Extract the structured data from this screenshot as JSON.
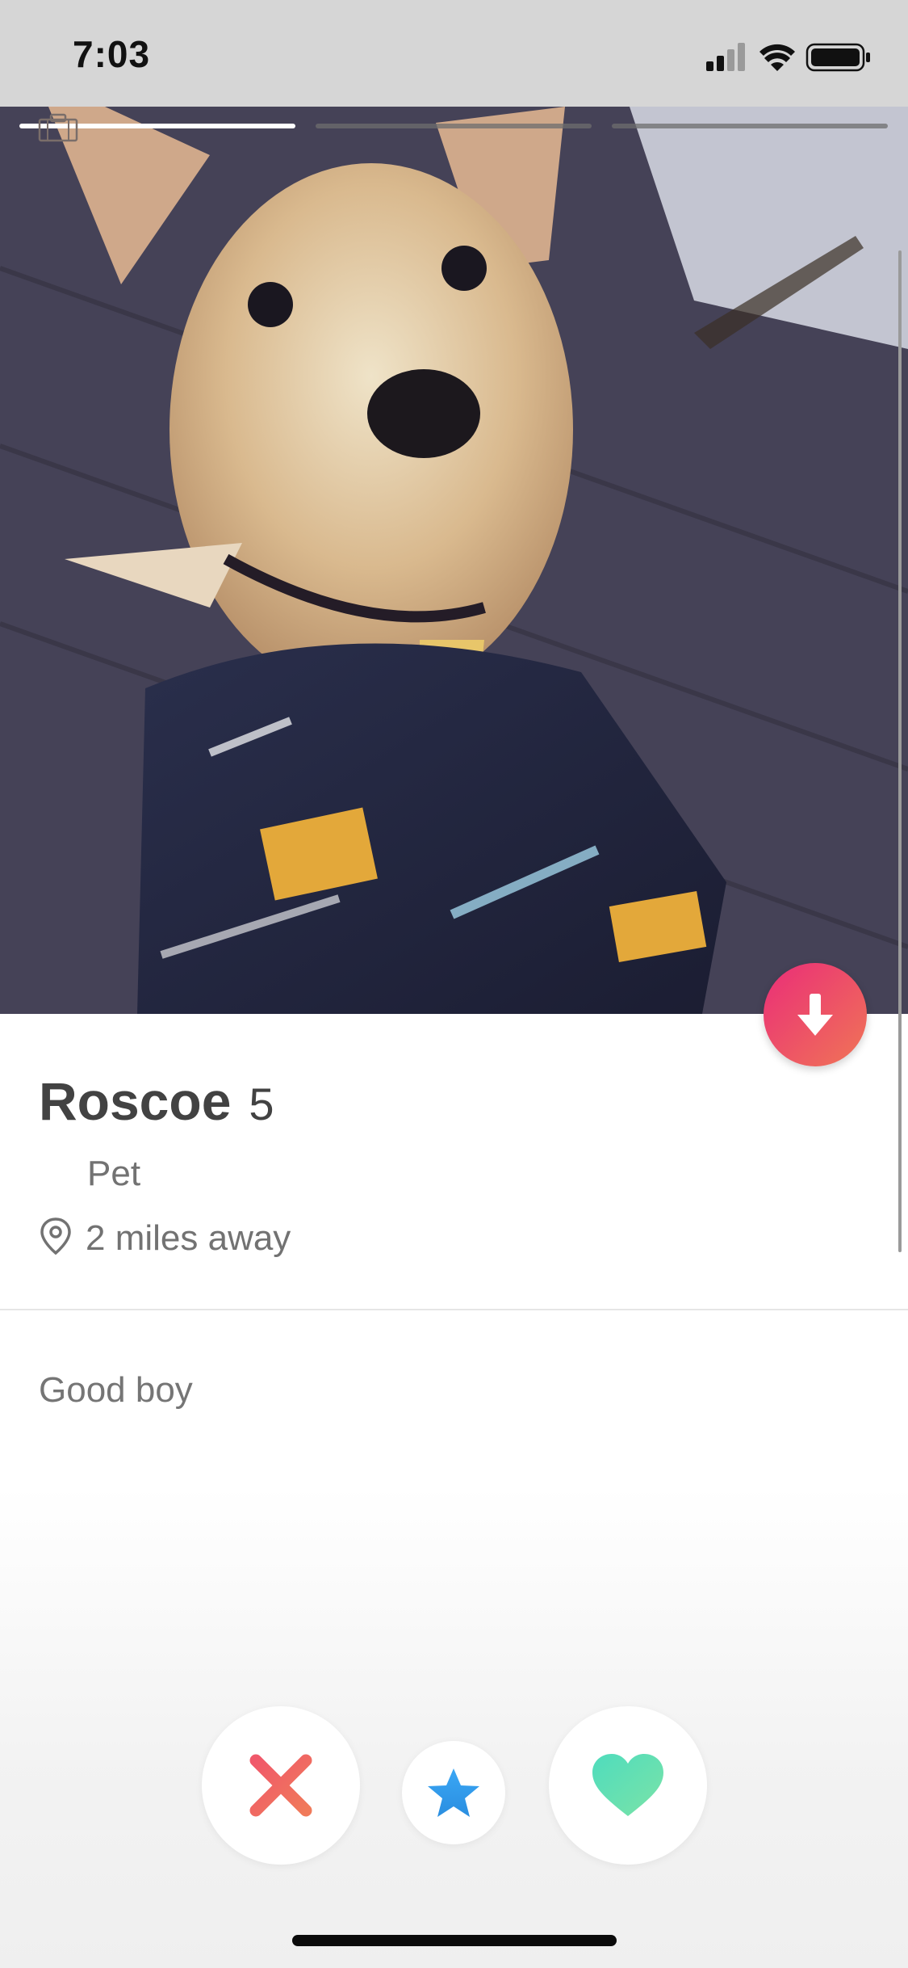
{
  "status_bar": {
    "time": "7:03",
    "icons": [
      "cellular-signal-icon",
      "wifi-icon",
      "battery-icon"
    ]
  },
  "photo": {
    "subject": "dog-photo",
    "pages_total": 3,
    "active_page": 1,
    "icon": "briefcase-icon"
  },
  "profile": {
    "name": "Roscoe",
    "age": "5",
    "job": "Pet",
    "distance": "2 miles away",
    "bio": "Good boy"
  },
  "actions": {
    "nope_icon": "close-x-icon",
    "super_like_icon": "star-icon",
    "like_icon": "heart-icon",
    "collapse_icon": "arrow-down-icon"
  },
  "colors": {
    "brand_gradient_start": "#ea2d78",
    "brand_gradient_end": "#f07556",
    "nope": "#ef5a6a",
    "super_like": "#2f9cf2",
    "like": "#5de0b6"
  }
}
